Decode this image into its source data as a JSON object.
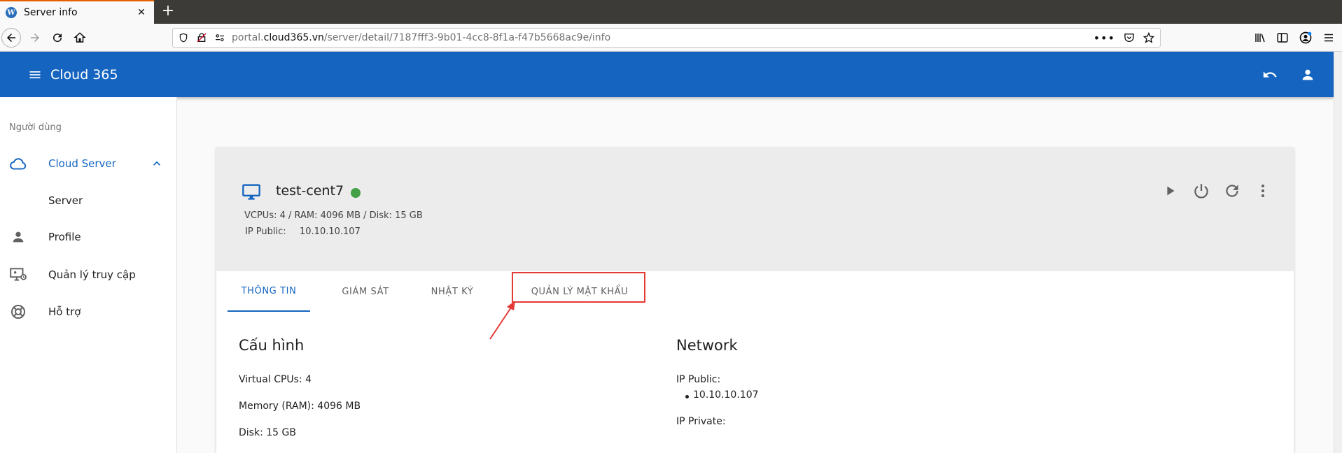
{
  "browser": {
    "tab_title": "Server info",
    "tab_favicon_letter": "W",
    "url_prefix": "portal.",
    "url_domain": "cloud365.vn",
    "url_path": "/server/detail/7187fff3-9b01-4cc8-8f1a-f47b5668ac9e/info",
    "new_tab_symbol": "+"
  },
  "app": {
    "title": "Cloud 365",
    "header_color": "#1565c0"
  },
  "sidebar": {
    "section": "Người dùng",
    "items": [
      {
        "label": "Cloud Server",
        "icon": "cloud-icon",
        "active": true
      },
      {
        "label": "Server",
        "icon": "",
        "active": false
      },
      {
        "label": "Profile",
        "icon": "person-icon",
        "active": false
      },
      {
        "label": "Quản lý truy cập",
        "icon": "monitor-access-icon",
        "active": false
      },
      {
        "label": "Hỗ trợ",
        "icon": "lifebuoy-icon",
        "active": false
      }
    ]
  },
  "server": {
    "name": "test-cent7",
    "status_color": "#43a047",
    "spec": "VCPUs: 4 / RAM: 4096 MB / Disk: 15 GB",
    "ip_label": "IP Public:",
    "ip_value": "10.10.10.107"
  },
  "tabs": [
    {
      "label": "THÔNG TIN",
      "active": true
    },
    {
      "label": "GIÁM SÁT",
      "active": false
    },
    {
      "label": "NHẬT KÝ",
      "active": false
    },
    {
      "label": "QUẢN LÝ MẬT KHẨU",
      "active": false
    }
  ],
  "config": {
    "title": "Cấu hình",
    "cpus": "Virtual CPUs: 4",
    "memory": "Memory (RAM): 4096 MB",
    "disk": "Disk: 15 GB"
  },
  "network": {
    "title": "Network",
    "ip_public_label": "IP Public:",
    "ip_public_values": [
      "10.10.10.107"
    ],
    "ip_private_label": "IP Private:"
  },
  "annotation_color": "#e53935"
}
